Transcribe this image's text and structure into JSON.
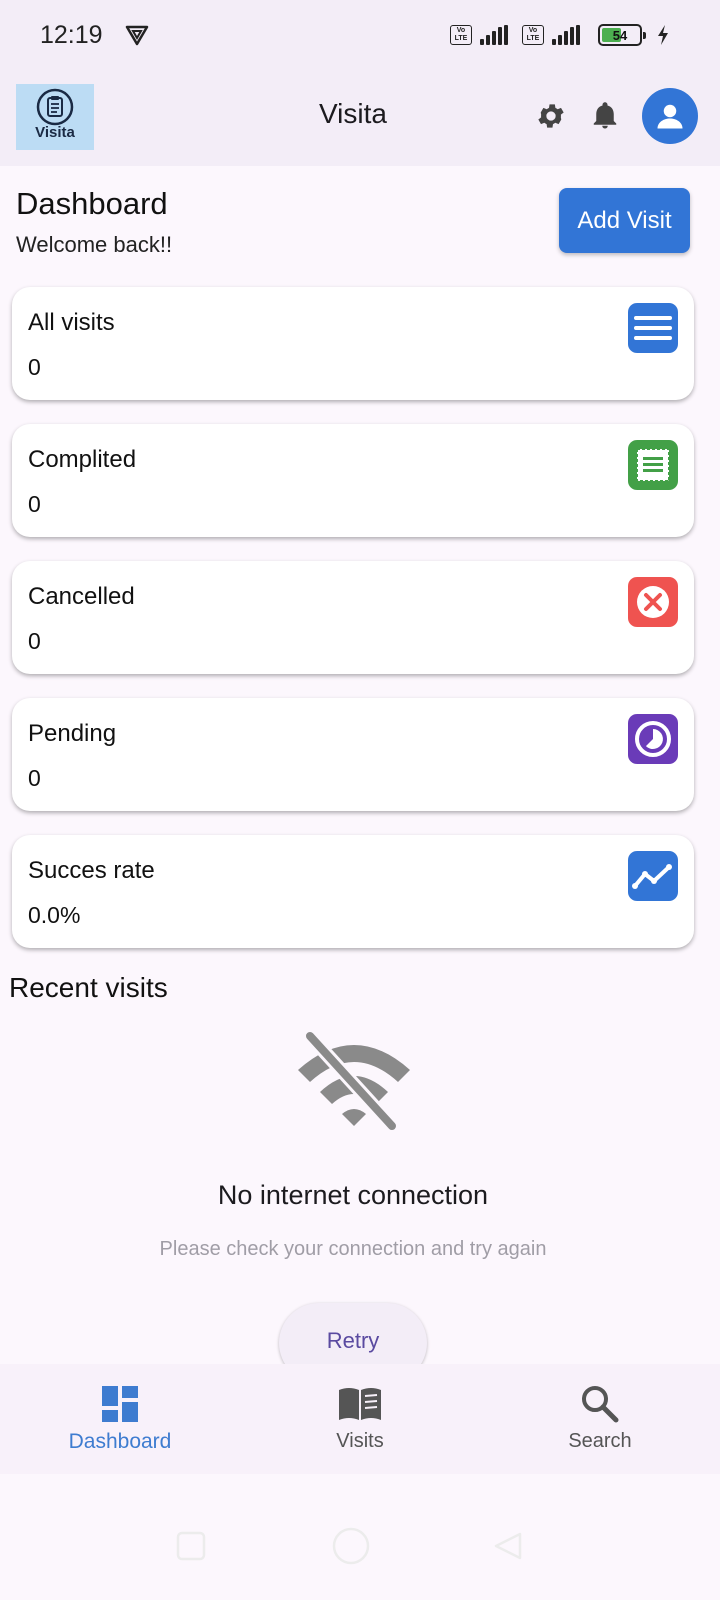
{
  "status_bar": {
    "time": "12:19",
    "battery_level": "54",
    "network_badge": "Vo LTE"
  },
  "app_bar": {
    "logo_text": "Visita",
    "title": "Visita"
  },
  "dashboard": {
    "title": "Dashboard",
    "subtitle": "Welcome back!!",
    "add_visit_label": "Add Visit"
  },
  "stats": [
    {
      "label": "All visits",
      "value": "0",
      "icon": "menu-icon",
      "color": "#3275d6"
    },
    {
      "label": "Complited",
      "value": "0",
      "icon": "receipt-icon",
      "color": "#43a047"
    },
    {
      "label": "Cancelled",
      "value": "0",
      "icon": "cancel-icon",
      "color": "#ef5350"
    },
    {
      "label": "Pending",
      "value": "0",
      "icon": "timelapse-icon",
      "color": "#6a3bb8"
    },
    {
      "label": "Succes rate",
      "value": "0.0%",
      "icon": "trending-icon",
      "color": "#3275d6"
    }
  ],
  "recent": {
    "title": "Recent visits",
    "offline_title": "No internet connection",
    "offline_message": "Please check your connection and try again",
    "retry_label": "Retry"
  },
  "bottom_nav": {
    "items": [
      {
        "label": "Dashboard",
        "icon": "dashboard-icon",
        "active": true
      },
      {
        "label": "Visits",
        "icon": "book-icon",
        "active": false
      },
      {
        "label": "Search",
        "icon": "search-icon",
        "active": false
      }
    ]
  },
  "colors": {
    "primary": "#3275d6",
    "appbar_bg": "#f3edf7",
    "page_bg": "#fcf7fd"
  }
}
